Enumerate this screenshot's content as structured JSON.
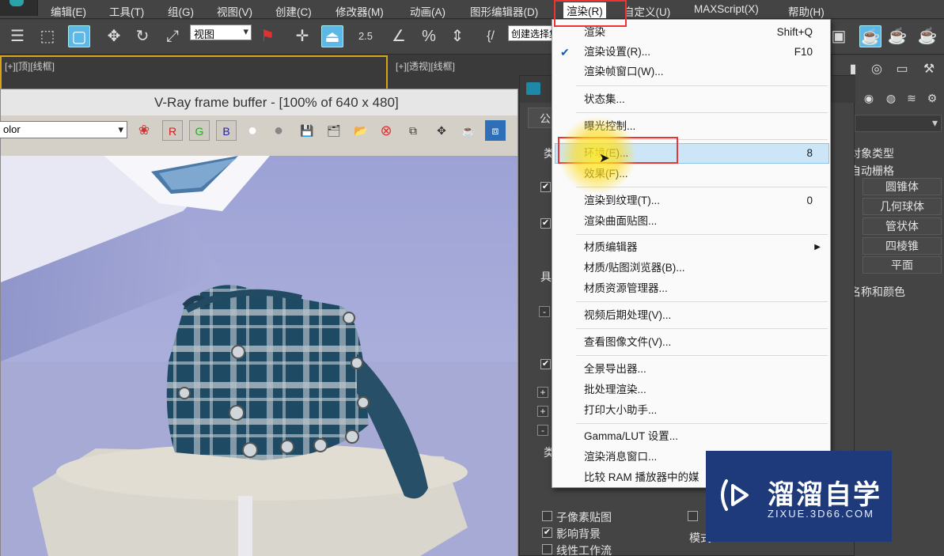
{
  "menubar": {
    "items": [
      "编辑(E)",
      "工具(T)",
      "组(G)",
      "视图(V)",
      "创建(C)",
      "修改器(M)",
      "动画(A)",
      "图形编辑器(D)",
      "渲染(R)",
      "自定义(U)",
      "MAXScript(X)",
      "帮助(H)"
    ]
  },
  "toolbar": {
    "view_select": "视图",
    "snap_angle": "2.5",
    "selection_set": "创建选择集"
  },
  "viewports": {
    "left_label": "[+][顶][线框]",
    "right_label": "[+][透视][线框]"
  },
  "vfb": {
    "title": "V-Ray frame buffer - [100% of 640 x 480]",
    "channel": "olor",
    "r": "R",
    "g": "G",
    "b": "B"
  },
  "render_menu": {
    "items": [
      {
        "label": "渲染",
        "shortcut": "Shift+Q"
      },
      {
        "label": "渲染设置(R)...",
        "shortcut": "F10",
        "checked": true
      },
      {
        "label": "渲染帧窗口(W)..."
      },
      {
        "label": "状态集..."
      },
      {
        "label": "曝光控制..."
      },
      {
        "label": "环境(E)...",
        "shortcut": "8"
      },
      {
        "label": "效果(F)..."
      },
      {
        "label": "渲染到纹理(T)...",
        "shortcut": "0"
      },
      {
        "label": "渲染曲面贴图..."
      },
      {
        "label": "材质编辑器"
      },
      {
        "label": "材质/贴图浏览器(B)..."
      },
      {
        "label": "材质资源管理器..."
      },
      {
        "label": "视频后期处理(V)..."
      },
      {
        "label": "查看图像文件(V)..."
      },
      {
        "label": "全景导出器..."
      },
      {
        "label": "批处理渲染..."
      },
      {
        "label": "打印大小助手..."
      },
      {
        "label": "Gamma/LUT 设置..."
      },
      {
        "label": "渲染消息窗口..."
      },
      {
        "label": "比较 RAM 播放器中的媒"
      }
    ]
  },
  "env_dialog": {
    "tab": "公",
    "side_labels": [
      "类",
      "具",
      "类"
    ],
    "bottom": {
      "subpixel": "子像素贴图",
      "affect_bg": "影响背景",
      "linear": "线性工作流",
      "mode": "模式"
    }
  },
  "command_panel": {
    "object_type": "对象类型",
    "auto_grid": "自动栅格",
    "buttons": [
      "圆锥体",
      "几何球体",
      "管状体",
      "四棱锥",
      "平面"
    ],
    "name_color": "名称和颜色"
  },
  "watermark": {
    "title": "溜溜自学",
    "sub": "ZIXUE.3D66.COM"
  },
  "colors": {
    "menu_highlight": "#cde6f7",
    "annotation": "#e33333",
    "active_tool": "#5cb8e6"
  }
}
